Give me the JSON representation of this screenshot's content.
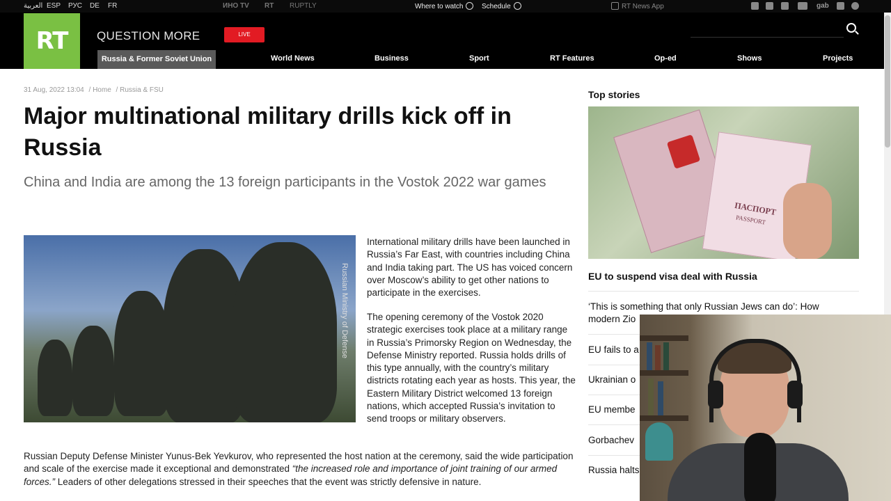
{
  "topbar": {
    "languages": [
      "العربية",
      "ESP",
      "РУС",
      "DE",
      "FR"
    ],
    "channels": [
      "ИНО TV",
      "RT",
      "RUPTLY"
    ],
    "where_to_watch": "Where to watch",
    "schedule": "Schedule",
    "app": "RT News App",
    "social_icons": [
      "telegram-icon",
      "rss-icon",
      "twitter-icon",
      "vk-icon",
      "gab-icon",
      "facebook-icon",
      "other-icon"
    ],
    "gab": "gab"
  },
  "header": {
    "logo": "RT",
    "slogan": "QUESTION MORE",
    "live": "LIVE",
    "nav": [
      "Russia & Former Soviet Union",
      "World News",
      "Business",
      "Sport",
      "RT Features",
      "Op-ed",
      "Shows",
      "Projects"
    ]
  },
  "article": {
    "meta": {
      "date": "31 Aug, 2022 13:04",
      "crumbs": [
        "/ Home",
        "/ Russia & FSU"
      ]
    },
    "title": "Major multinational military drills kick off in Russia",
    "subtitle": "China and India are among the 13 foreign participants in the Vostok 2022 war games",
    "photo_credit": "Russian Ministry of Defense",
    "para1": "International military drills have been launched in Russia’s Far East, with countries including China and India taking part. The US has voiced concern over Moscow’s ability to get other nations to participate in the exercises.",
    "para2": "The opening ceremony of the Vostok 2020 strategic exercises took place at a military range in Russia’s Primorsky Region on Wednesday, the Defense Ministry reported. Russia holds drills of this type annually, with the country’s military districts rotating each year as hosts. This year, the Eastern Military District welcomed 13 foreign nations, which accepted Russia’s invitation to send troops or military observers.",
    "para3_start": "Russian Deputy Defense Minister Yunus-Bek Yevkurov, who represented the host nation at the ceremony, said the wide participation and scale of the exercise made it exceptional and demonstrated ",
    "para3_quote": "“the increased role and importance of joint training of our armed forces.”",
    "para3_end": " Leaders of other delegations stressed in their speeches that the event was strictly defensive in nature."
  },
  "sidebar": {
    "title": "Top stories",
    "passport_title": "ПАСПОРТ",
    "passport_sub": "PASSPORT",
    "lead": "EU to suspend visa deal with Russia",
    "stories": [
      "‘This is something that only Russian Jews can do’: How modern Zio",
      "EU fails to a",
      "Ukrainian o",
      "EU membe",
      "Gorbachev",
      "Russia halts"
    ]
  },
  "colors": {
    "brand_green": "#7ac043",
    "live_red": "#e21b23",
    "header_bg": "#000000"
  }
}
